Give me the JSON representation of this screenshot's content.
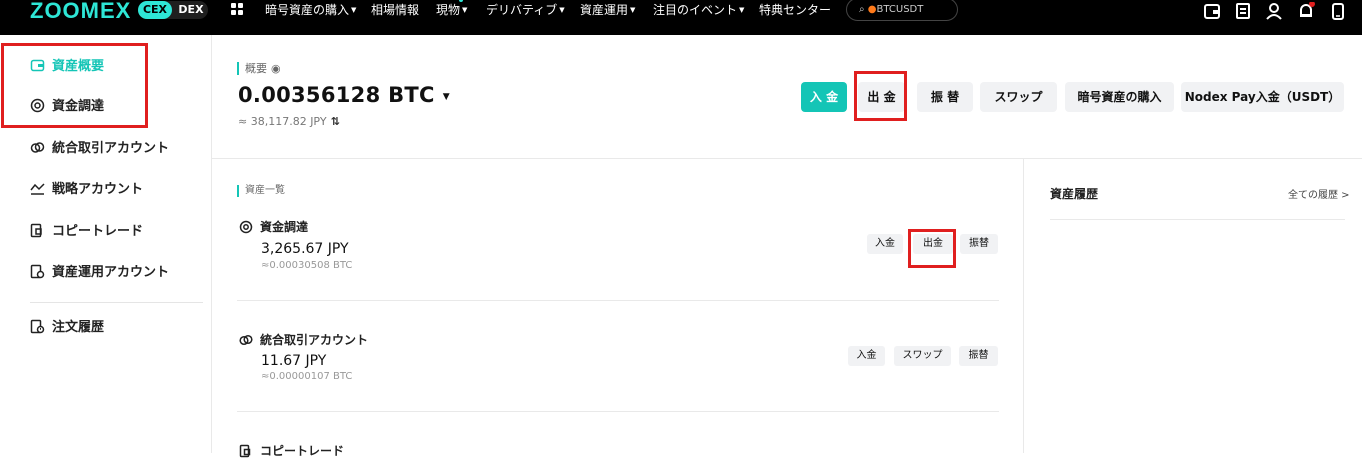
{
  "header": {
    "logo": "ZOOMEX",
    "mode": {
      "cex": "CEX",
      "dex": "DEX"
    },
    "apps_icon": "grid-icon",
    "nav": [
      {
        "label": "暗号資産の購入",
        "caret": "▼"
      },
      {
        "label": "相場情報",
        "caret": ""
      },
      {
        "label": "現物",
        "caret": "▼"
      },
      {
        "label": "デリバティブ",
        "caret": "▼"
      },
      {
        "label": "資産運用",
        "caret": "▼"
      },
      {
        "label": "注目のイベント",
        "caret": "▼"
      },
      {
        "label": "特典センター",
        "caret": ""
      }
    ],
    "search_value": "BTCUSDT",
    "right_icons": [
      "wallet-icon",
      "orders-icon",
      "user-icon",
      "bell-icon",
      "mobile-icon"
    ]
  },
  "sidebar": {
    "items": [
      {
        "label": "資産概要",
        "icon": "wallet-icon",
        "active": true
      },
      {
        "label": "資金調達",
        "icon": "target-icon",
        "active": false
      },
      {
        "label": "統合取引アカウント",
        "icon": "link-icon",
        "active": false
      },
      {
        "label": "戦略アカウント",
        "icon": "strategy-icon",
        "active": false
      },
      {
        "label": "コピートレード",
        "icon": "copy-icon",
        "active": false
      },
      {
        "label": "資産運用アカウント",
        "icon": "earn-icon",
        "active": false
      },
      {
        "label": "注文履歴",
        "icon": "history-icon",
        "active": false
      }
    ]
  },
  "overview": {
    "label": "概要",
    "balance": "0.00356128 BTC",
    "approx": "≈ 38,117.82 JPY",
    "swap_symbol": "⇅",
    "actions": {
      "deposit": "入 金",
      "withdraw": "出 金",
      "transfer": "振 替",
      "swap": "スワップ",
      "buy": "暗号資産の購入",
      "nodex": "Nodex Pay入金（USDT）"
    }
  },
  "asset_list": {
    "title": "資産一覧",
    "accounts": [
      {
        "name": "資金調達",
        "icon": "target-icon",
        "amount": "3,265.67 JPY",
        "btc": "≈0.00030508 BTC",
        "buttons": [
          "入金",
          "出金",
          "振替"
        ]
      },
      {
        "name": "統合取引アカウント",
        "icon": "link-icon",
        "amount": "11.67 JPY",
        "btc": "≈0.00000107 BTC",
        "buttons": [
          "入金",
          "スワップ",
          "振替"
        ]
      },
      {
        "name": "コピートレード",
        "icon": "copy-icon"
      }
    ]
  },
  "history": {
    "title": "資産履歴",
    "all_link": "全ての履歴 >"
  },
  "colors": {
    "accent": "#14c5b6",
    "highlight": "#e01f1f",
    "topbar": "#000000"
  }
}
